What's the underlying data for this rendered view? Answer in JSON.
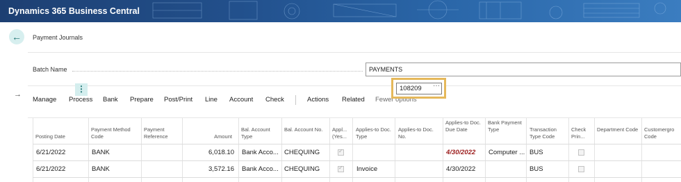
{
  "app": {
    "title": "Dynamics 365 Business Central"
  },
  "page": {
    "title": "Payment Journals",
    "back_icon": "arrow-left-icon"
  },
  "batch": {
    "label": "Batch Name",
    "value": "PAYMENTS"
  },
  "actions": {
    "items": [
      "Manage",
      "Process",
      "Bank",
      "Prepare",
      "Post/Print",
      "Line",
      "Account",
      "Check"
    ],
    "secondary": [
      "Actions",
      "Related"
    ],
    "fewer_options": "Fewer options"
  },
  "table": {
    "headers": {
      "posting_date": "Posting Date",
      "payment_method_code": "Payment Method Code",
      "payment_reference": "Payment Reference",
      "amount": "Amount",
      "bal_account_type": "Bal. Account Type",
      "bal_account_no": "Bal. Account No.",
      "applies_yes": "Appl... (Yes...",
      "applies_to_doc_type": "Applies-to Doc. Type",
      "applies_to_doc_no": "Applies-to Doc. No.",
      "applies_to_doc_due_date": "Applies-to Doc. Due Date",
      "bank_payment_type": "Bank Payment Type",
      "transaction_type_code": "Transaction Type Code",
      "check_printed": "Check Prin...",
      "department_code": "Department Code",
      "customergroup_code": "Customergro Code"
    },
    "rows": [
      {
        "posting_date": "6/21/2022",
        "payment_method_code": "BANK",
        "payment_reference": "",
        "amount": "6,018.10",
        "bal_account_type": "Bank Acco...",
        "bal_account_no": "CHEQUING",
        "applies_yes": true,
        "applies_to_doc_type": "",
        "applies_to_doc_no": "",
        "applies_to_doc_due_date": "4/30/2022",
        "bank_payment_type": "Computer ...",
        "transaction_type_code": "BUS",
        "check_printed": false
      },
      {
        "posting_date": "6/21/2022",
        "payment_method_code": "BANK",
        "payment_reference": "",
        "amount": "3,572.16",
        "bal_account_type": "Bank Acco...",
        "bal_account_no": "CHEQUING",
        "applies_yes": true,
        "applies_to_doc_type": "Invoice",
        "applies_to_doc_no": "108209",
        "applies_to_doc_due_date": "4/30/2022",
        "bank_payment_type": "",
        "transaction_type_code": "BUS",
        "check_printed": false
      }
    ],
    "row_menu_icon": "more-vertical-icon",
    "current_row_icon": "arrow-right-icon",
    "lookup_icon": "ellipsis-icon"
  },
  "colors": {
    "accent": "#1a6f6f",
    "highlight": "#e5b85a",
    "overdue": "#9b1c1c",
    "header_bar": "#22508c"
  }
}
